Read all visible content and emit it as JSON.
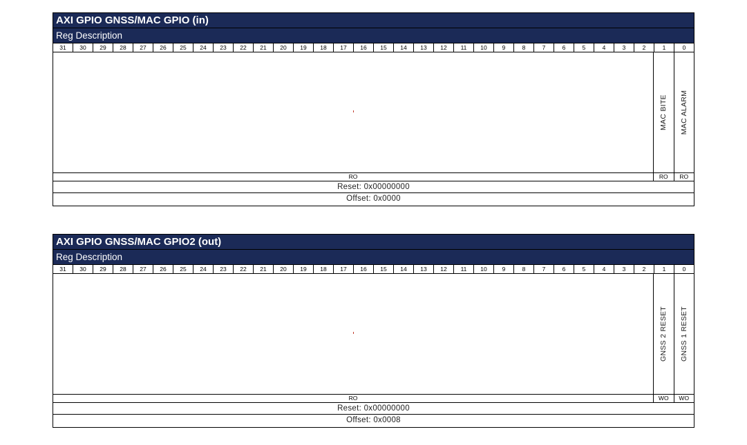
{
  "bits": [
    "31",
    "30",
    "29",
    "28",
    "27",
    "26",
    "25",
    "24",
    "23",
    "22",
    "21",
    "20",
    "19",
    "18",
    "17",
    "16",
    "15",
    "14",
    "13",
    "12",
    "11",
    "10",
    "9",
    "8",
    "7",
    "6",
    "5",
    "4",
    "3",
    "2",
    "1",
    "0"
  ],
  "registers": [
    {
      "title": "AXI GPIO GNSS/MAC GPIO (in)",
      "description_label": "Reg Description",
      "fields": [
        "MAC BITE",
        "MAC ALARM"
      ],
      "reserved_access": "RO",
      "field_access": [
        "RO",
        "RO"
      ],
      "reset": "Reset: 0x00000000",
      "offset": "Offset: 0x0000"
    },
    {
      "title": "AXI GPIO GNSS/MAC GPIO2 (out)",
      "description_label": "Reg Description",
      "fields": [
        "GNSS 2 RESET",
        "GNSS 1 RESET"
      ],
      "reserved_access": "RO",
      "field_access": [
        "WO",
        "WO"
      ],
      "reset": "Reset: 0x00000000",
      "offset": "Offset: 0x0008"
    }
  ],
  "colors": {
    "header_bg": "#1b2a57",
    "header_text": "#ffffff",
    "border": "#000000"
  }
}
